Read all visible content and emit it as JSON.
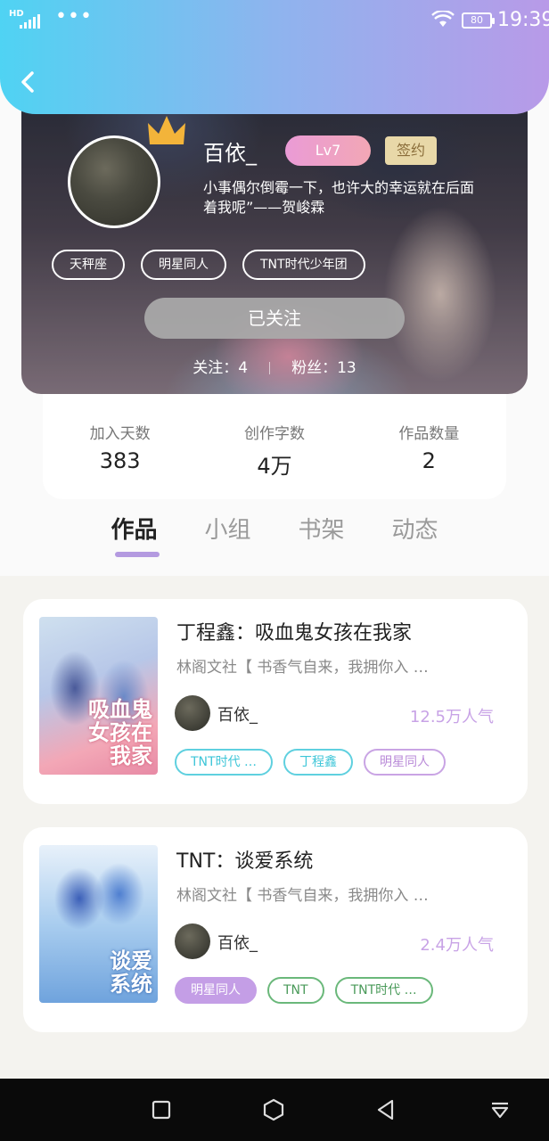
{
  "status_bar": {
    "hd": "HD",
    "battery": "80",
    "time": "19:39",
    "dots": "•••"
  },
  "profile": {
    "username": "百依_",
    "level": "Lv7",
    "sign_badge": "签约",
    "bio_line1": "小事偶尔倒霉一下，也许大的幸运就在后面",
    "bio_line2": "着我呢”——贺峻霖",
    "tags": [
      "天秤座",
      "明星同人",
      "TNT时代少年团"
    ],
    "follow_label": "已关注",
    "following_label": "关注：4",
    "fans_label": "粉丝：13"
  },
  "stats": [
    {
      "label": "加入天数",
      "value": "383"
    },
    {
      "label": "创作字数",
      "value": "4万"
    },
    {
      "label": "作品数量",
      "value": "2"
    }
  ],
  "tabs": [
    "作品",
    "小组",
    "书架",
    "动态"
  ],
  "works": [
    {
      "title": "丁程鑫：吸血鬼女孩在我家",
      "desc": "林阁文社【 书香气自来，我拥你入 …",
      "author": "百依_",
      "popularity": "12.5万人气",
      "cover_text": "吸血鬼女孩在我家",
      "tags": [
        "TNT时代 …",
        "丁程鑫",
        "明星同人"
      ]
    },
    {
      "title": "TNT：谈爱系统",
      "desc": "林阁文社【 书香气自来，我拥你入 …",
      "author": "百依_",
      "popularity": "2.4万人气",
      "cover_text": "谈爱系统",
      "tags": [
        "明星同人",
        "TNT",
        "TNT时代 …"
      ]
    }
  ],
  "icons": {
    "back": "chevron-left-icon",
    "wifi": "wifi-icon",
    "crown": "crown-icon",
    "nav": [
      "recent-apps-icon",
      "home-icon",
      "back-icon",
      "notification-shade-icon"
    ]
  },
  "colors": {
    "gradient_start": "#4fd3f3",
    "gradient_end": "#b89ae8",
    "accent_purple": "#b49ae0",
    "teal": "#3ec6d8"
  }
}
